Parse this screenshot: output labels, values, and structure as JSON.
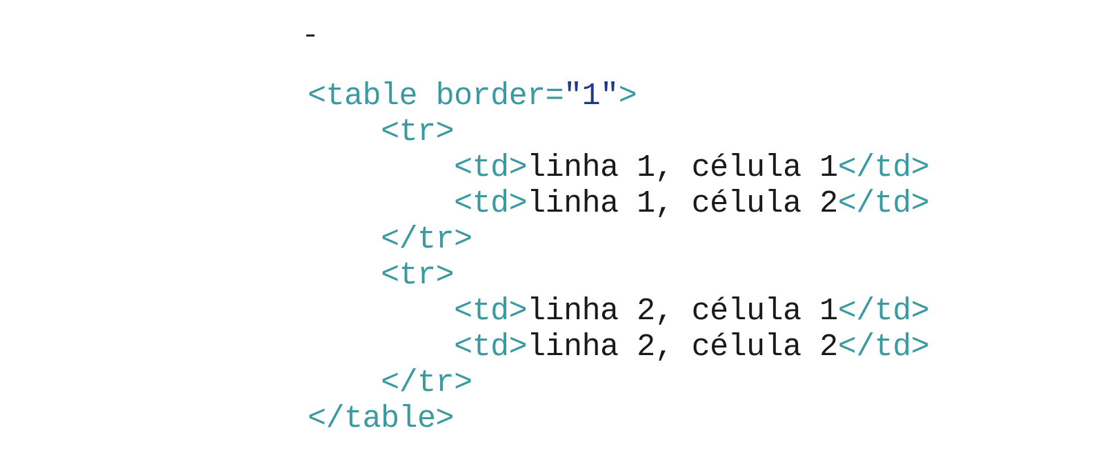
{
  "lines": [
    {
      "indent": "",
      "parts": [
        "<table",
        " ",
        "border=\"1\"",
        ">"
      ]
    },
    {
      "indent": "    ",
      "parts": [
        "<tr>"
      ]
    },
    {
      "indent": "        ",
      "parts": [
        "<td>",
        "linha 1, célula 1",
        "</td>"
      ]
    },
    {
      "indent": "        ",
      "parts": [
        "<td>",
        "linha 1, célula 2",
        "</td>"
      ]
    },
    {
      "indent": "    ",
      "parts": [
        "</tr>"
      ]
    },
    {
      "indent": "    ",
      "parts": [
        "<tr>"
      ]
    },
    {
      "indent": "        ",
      "parts": [
        "<td>",
        "linha 2, célula 1",
        "</td>"
      ]
    },
    {
      "indent": "        ",
      "parts": [
        "<td>",
        "linha 2, célula 2",
        "</td>"
      ]
    },
    {
      "indent": "    ",
      "parts": [
        "</tr>"
      ]
    },
    {
      "indent": "",
      "parts": [
        "</table>"
      ]
    }
  ],
  "colors": {
    "tag": "#3a9aa0",
    "text": "#1a1a1a",
    "attribute_value": "#1e3a8a",
    "background": "#ffffff"
  }
}
